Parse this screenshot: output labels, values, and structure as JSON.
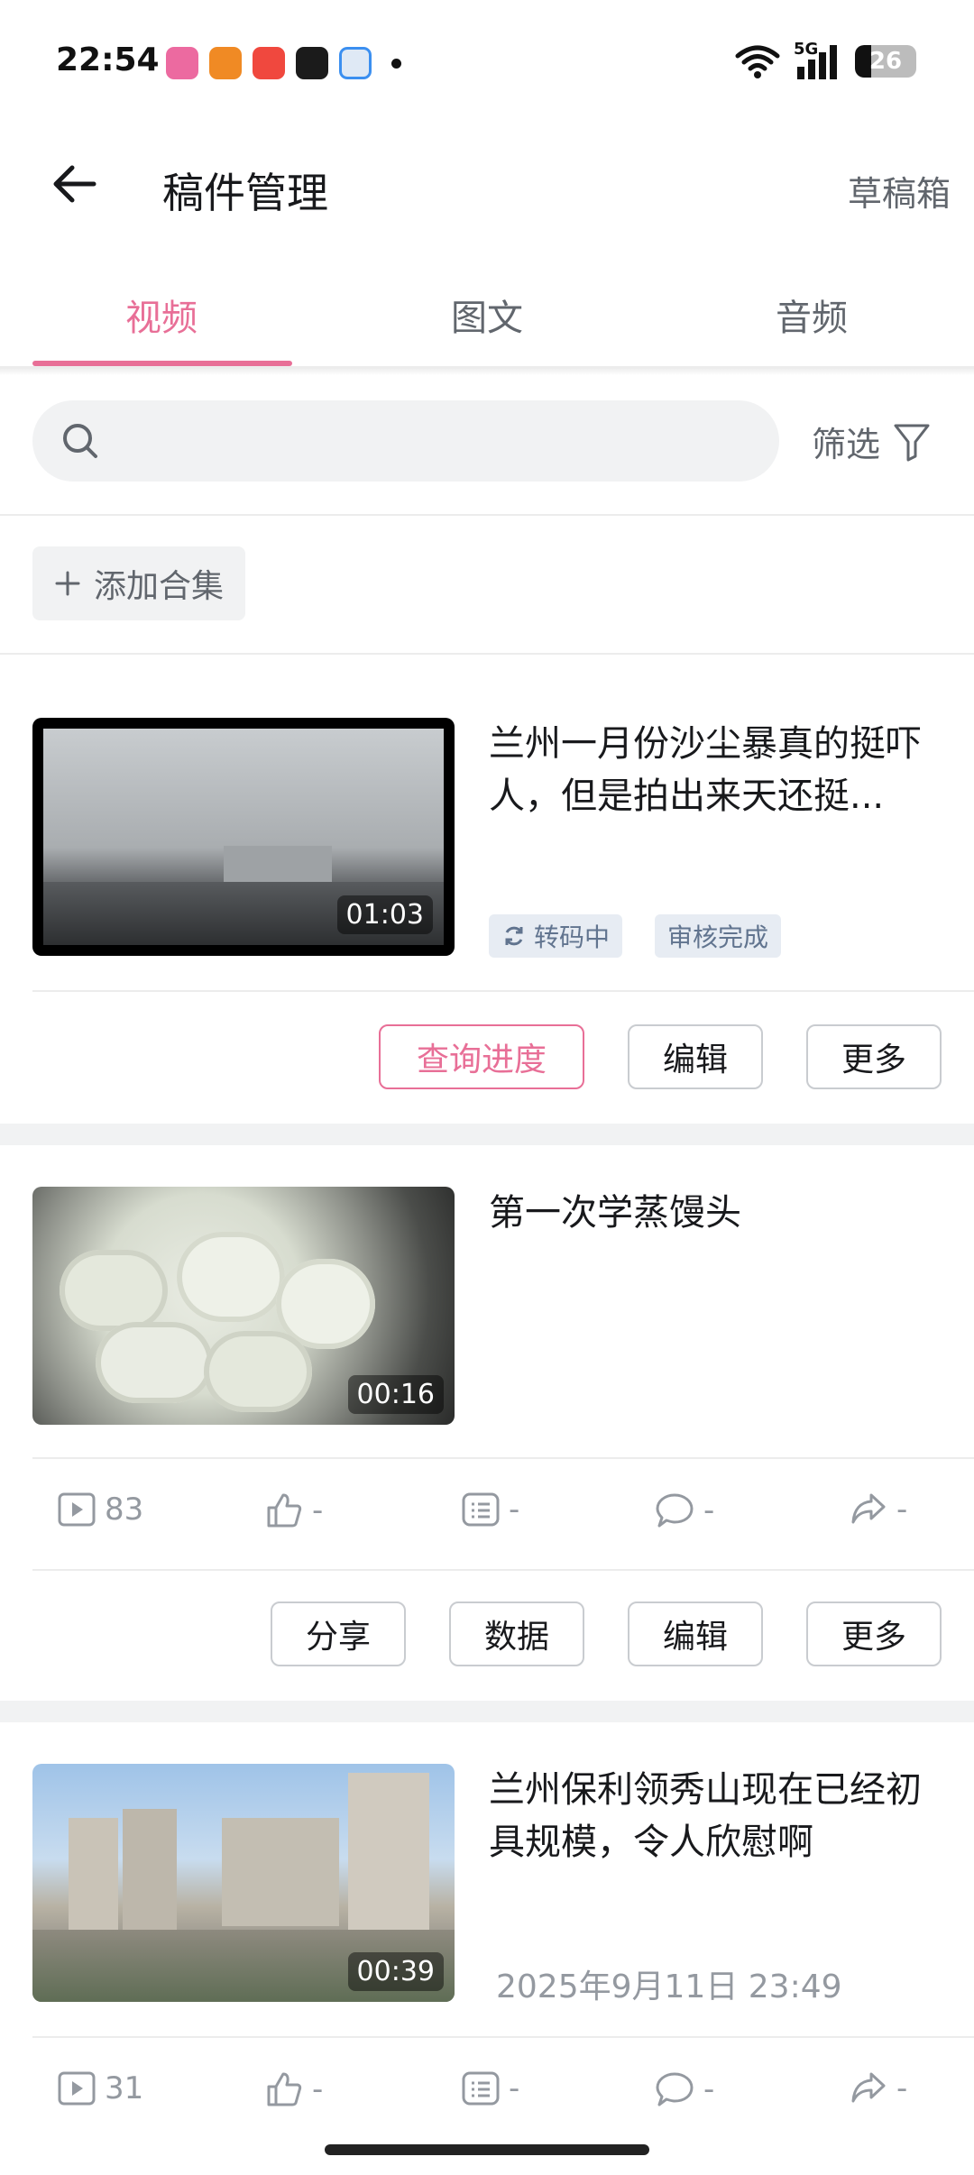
{
  "status_bar": {
    "time": "22:54",
    "signal_label": "5G",
    "battery": "26",
    "battery_level": 0.26,
    "app_icons": [
      "bilibili-app-icon",
      "sogou-app-icon",
      "video-app-icon",
      "soul-app-icon",
      "browser-app-icon"
    ]
  },
  "header": {
    "title": "稿件管理",
    "draft_link": "草稿箱"
  },
  "tabs": [
    {
      "label": "视频",
      "active": true
    },
    {
      "label": "图文",
      "active": false
    },
    {
      "label": "音频",
      "active": false
    }
  ],
  "search": {
    "placeholder": ""
  },
  "filter_label": "筛选",
  "add_collection_label": "添加合集",
  "accent_color": "#e86f97",
  "items": [
    {
      "title": "兰州一月份沙尘暴真的挺吓人，但是拍出来天还挺...",
      "duration": "01:03",
      "badges": [
        "转码中",
        "审核完成"
      ],
      "actions": [
        "查询进度",
        "编辑",
        "更多"
      ]
    },
    {
      "title": "第一次学蒸馒头",
      "duration": "00:16",
      "stats": {
        "plays": "83",
        "likes": "-",
        "danmaku": "-",
        "comments": "-",
        "shares": "-"
      },
      "actions": [
        "分享",
        "数据",
        "编辑",
        "更多"
      ]
    },
    {
      "title": "兰州保利领秀山现在已经初具规模，令人欣慰啊",
      "duration": "00:39",
      "date": "2025年9月11日 23:49",
      "stats": {
        "plays": "31",
        "likes": "-",
        "danmaku": "-",
        "comments": "-",
        "shares": "-"
      }
    }
  ]
}
